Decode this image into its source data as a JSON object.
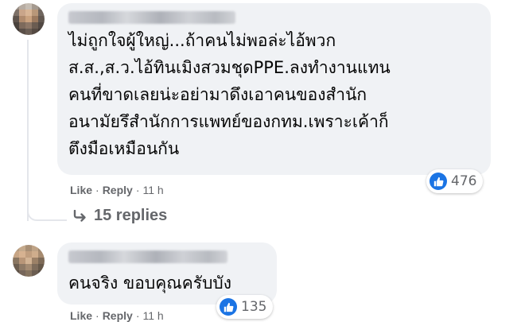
{
  "comments": [
    {
      "text": "ไม่ถูกใจผู้ใหญ่...ถ้าคนไม่พอล่ะไอ้พวก\nส.ส.,ส.ว.ไอ้ทินเมิงสวมชุดPPE.ลงทำงานแทน\nคนที่ขาดเลยน่ะอย่ามาดึงเอาคนของสำนัก\nอนามัยรึสำนักการแพทย์ของกทม.เพราะเค้าก็\nตึงมือเหมือนกัน",
      "reaction_count": "476",
      "like_label": "Like",
      "reply_label": "Reply",
      "separator": "·",
      "time": "11 h"
    },
    {
      "text": "คนจริง ขอบคุณครับบัง",
      "reaction_count": "135",
      "like_label": "Like",
      "reply_label": "Reply",
      "separator": "·",
      "time": "11 h"
    }
  ],
  "replies": {
    "label": "15 replies",
    "icon": "reply-arrow-icon"
  },
  "colors": {
    "bubble": "#f0f2f5",
    "text": "#050505",
    "secondary": "#65676b",
    "like_blue": "#1b74e4"
  }
}
